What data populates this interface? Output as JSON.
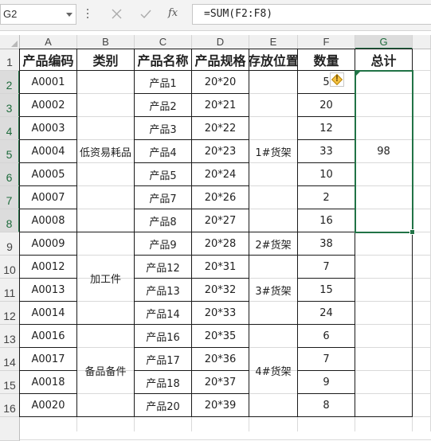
{
  "formula_bar": {
    "cell_ref": "G2",
    "formula": "=SUM(F2:F8)",
    "fx_label": "fx"
  },
  "sheet": {
    "columns": [
      "A",
      "B",
      "C",
      "D",
      "E",
      "F",
      "G"
    ],
    "selected_column": "G",
    "selected_rows": [
      "2",
      "3",
      "4",
      "5",
      "6",
      "7",
      "8"
    ],
    "headers": [
      "产品编码",
      "类别",
      "产品名称",
      "产品规格",
      "存放位置",
      "数量",
      "总计"
    ],
    "rows": [
      {
        "num": "2",
        "code": "A0001",
        "name": "产品1",
        "spec": "20*20",
        "qty": "5"
      },
      {
        "num": "3",
        "code": "A0002",
        "name": "产品2",
        "spec": "20*21",
        "qty": "20"
      },
      {
        "num": "4",
        "code": "A0003",
        "name": "产品3",
        "spec": "20*22",
        "qty": "12"
      },
      {
        "num": "5",
        "code": "A0004",
        "name": "产品4",
        "spec": "20*23",
        "qty": "33"
      },
      {
        "num": "6",
        "code": "A0005",
        "name": "产品5",
        "spec": "20*24",
        "qty": "10"
      },
      {
        "num": "7",
        "code": "A0007",
        "name": "产品7",
        "spec": "20*26",
        "qty": "2"
      },
      {
        "num": "8",
        "code": "A0008",
        "name": "产品8",
        "spec": "20*27",
        "qty": "16"
      },
      {
        "num": "9",
        "code": "A0009",
        "name": "产品9",
        "spec": "20*28",
        "qty": "38"
      },
      {
        "num": "10",
        "code": "A0012",
        "name": "产品12",
        "spec": "20*31",
        "qty": "7"
      },
      {
        "num": "11",
        "code": "A0013",
        "name": "产品13",
        "spec": "20*32",
        "qty": "15"
      },
      {
        "num": "12",
        "code": "A0014",
        "name": "产品14",
        "spec": "20*33",
        "qty": "24"
      },
      {
        "num": "13",
        "code": "A0016",
        "name": "产品16",
        "spec": "20*35",
        "qty": "6"
      },
      {
        "num": "14",
        "code": "A0017",
        "name": "产品17",
        "spec": "20*36",
        "qty": "7"
      },
      {
        "num": "15",
        "code": "A0018",
        "name": "产品18",
        "spec": "20*37",
        "qty": "9"
      },
      {
        "num": "16",
        "code": "A0020",
        "name": "产品20",
        "spec": "20*39",
        "qty": "8"
      }
    ],
    "categories": [
      {
        "label": "低资易耗品",
        "first": 0,
        "last": 6
      },
      {
        "label": "加工件",
        "first": 7,
        "last": 10
      },
      {
        "label": "备品备件",
        "first": 11,
        "last": 14
      }
    ],
    "locations": [
      {
        "label": "1#货架",
        "first": 0,
        "last": 6
      },
      {
        "label": "2#货架",
        "first": 7,
        "last": 7
      },
      {
        "label": "3#货架",
        "first": 8,
        "last": 10
      },
      {
        "label": "4#货架",
        "first": 11,
        "last": 14
      }
    ],
    "total": {
      "value": "98",
      "first": 0,
      "last": 6
    },
    "warning_icon": "warning-diamond-icon",
    "colors": {
      "selection": "#217346",
      "border": "#1a1a1a",
      "gridline": "#d9d9d9",
      "header_bg": "#f0f0f0"
    }
  }
}
